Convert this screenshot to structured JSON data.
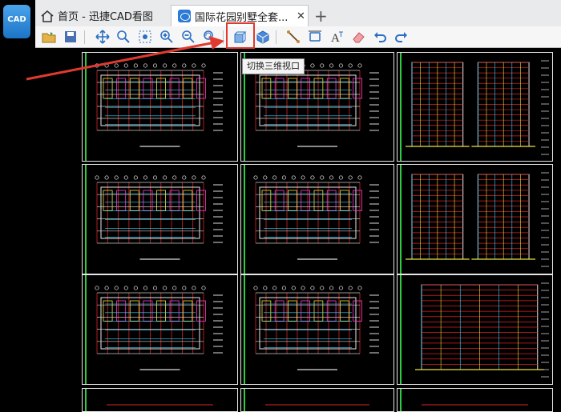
{
  "app": {
    "icon_label": "CAD"
  },
  "tabs": [
    {
      "label": "首页 - 迅捷CAD看图",
      "icon": "home-icon"
    },
    {
      "label": "国际花园别墅全套...",
      "icon": "cad-document-icon",
      "close": "✕"
    }
  ],
  "new_tab_label": "+",
  "toolbar": {
    "items": [
      "open-file-icon",
      "save-icon",
      "pan-icon",
      "zoom-realtime-icon",
      "zoom-window-icon",
      "zoom-in-icon",
      "zoom-out-icon",
      "zoom-previous-icon",
      "switch-3d-view-icon",
      "3d-view-icon",
      "measure-line-icon",
      "measure-area-icon",
      "text-icon",
      "eraser-icon",
      "undo-icon",
      "redo-icon"
    ]
  },
  "tooltip": {
    "text": "切换三维视口"
  },
  "colors": {
    "highlight": "#e03a30",
    "canvas": "#000000",
    "accent": "#1c74c7"
  }
}
